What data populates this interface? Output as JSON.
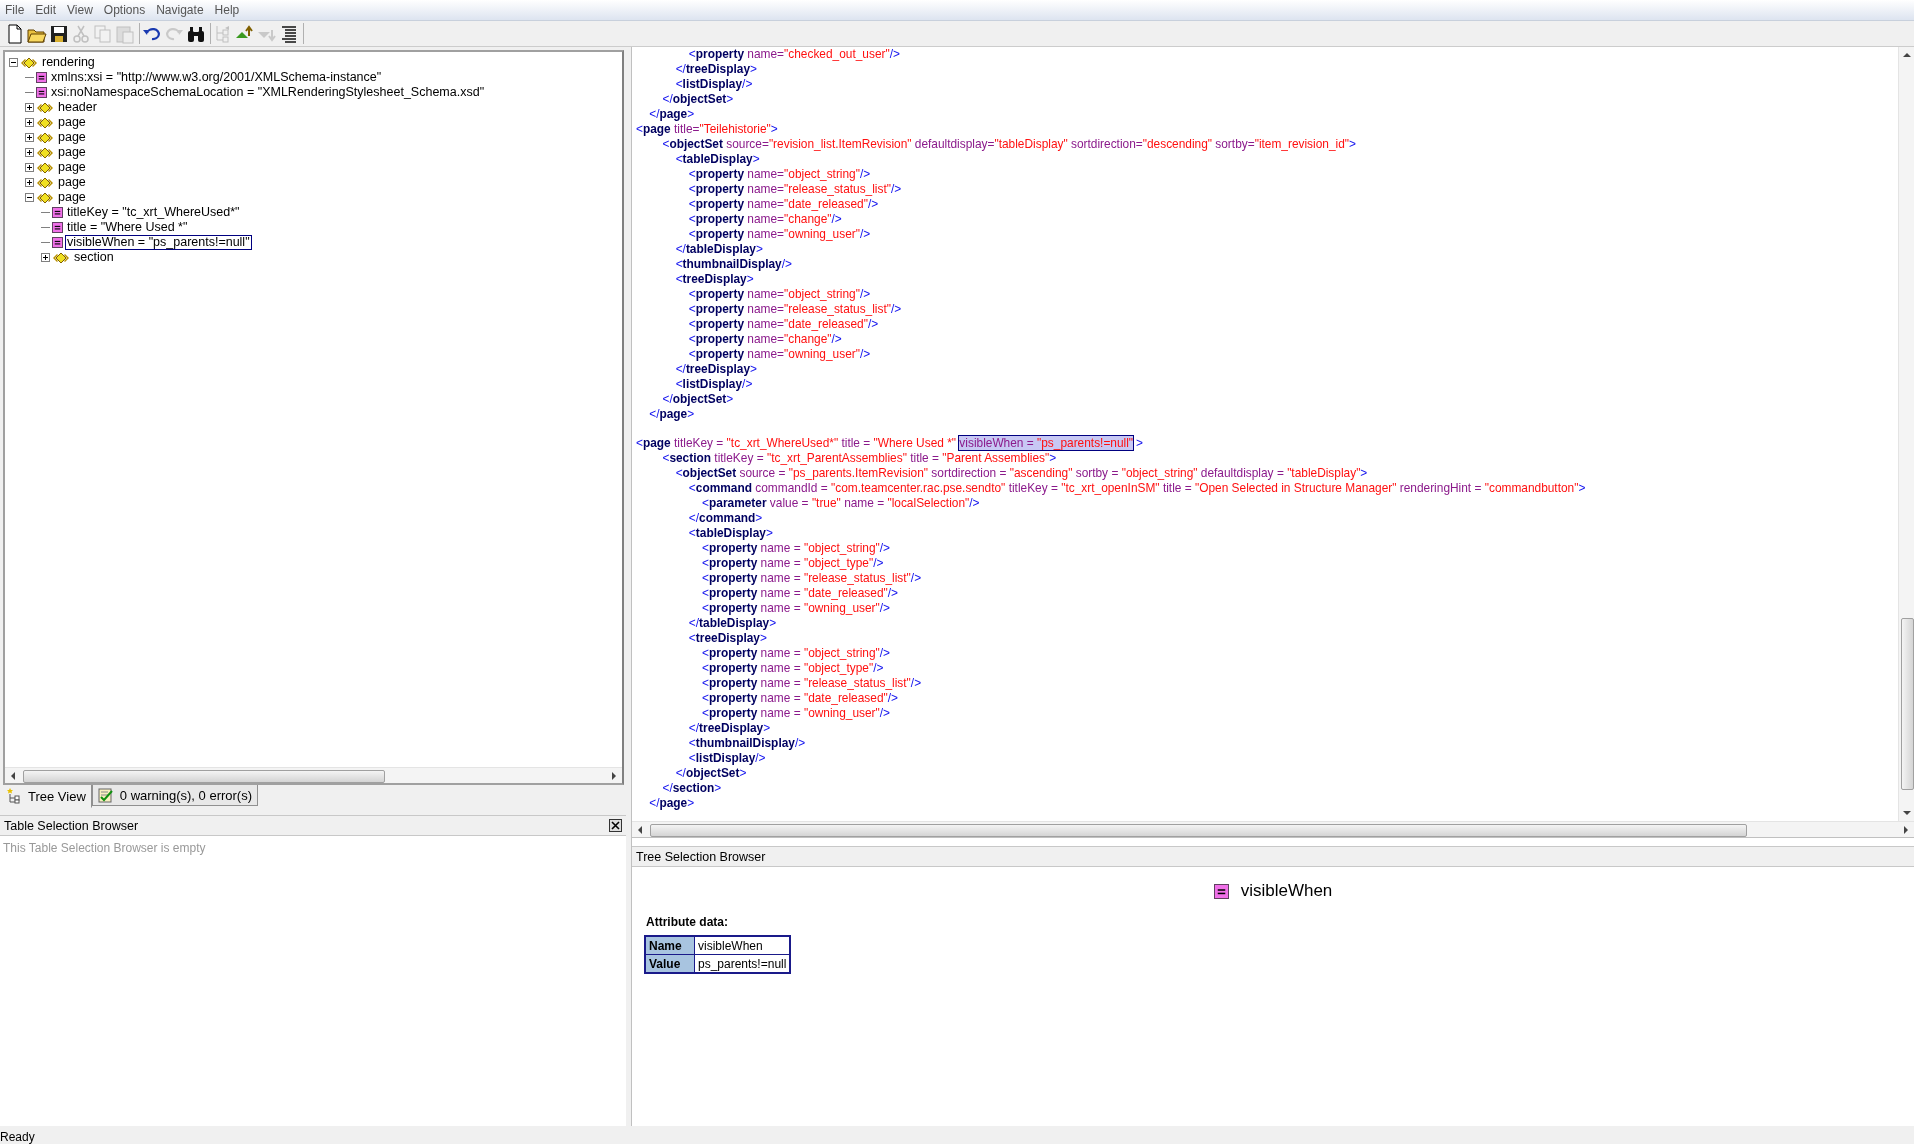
{
  "menu": [
    "File",
    "Edit",
    "View",
    "Options",
    "Navigate",
    "Help"
  ],
  "toolbar": [
    [
      {
        "kind": "new",
        "disabled": false
      },
      {
        "kind": "open",
        "disabled": false
      },
      {
        "kind": "save",
        "disabled": false
      },
      {
        "kind": "cut",
        "disabled": true
      },
      {
        "kind": "copy",
        "disabled": true
      },
      {
        "kind": "paste",
        "disabled": true
      }
    ],
    [
      {
        "kind": "undo",
        "disabled": false
      },
      {
        "kind": "redo",
        "disabled": true
      },
      {
        "kind": "find",
        "disabled": false
      }
    ],
    [
      {
        "kind": "tree",
        "disabled": true
      },
      {
        "kind": "up",
        "disabled": false
      },
      {
        "kind": "down",
        "disabled": true
      },
      {
        "kind": "list",
        "disabled": false
      }
    ]
  ],
  "tree": [
    {
      "kind": "element",
      "label": "rendering",
      "expanded": true,
      "selected": false,
      "children": [
        {
          "kind": "attribute",
          "label": "xmlns:xsi = \"http://www.w3.org/2001/XMLSchema-instance\"",
          "selected": false
        },
        {
          "kind": "attribute",
          "label": "xsi:noNamespaceSchemaLocation = \"XMLRenderingStylesheet_Schema.xsd\"",
          "selected": false
        },
        {
          "kind": "element",
          "label": "header",
          "expanded": false,
          "selected": false
        },
        {
          "kind": "element",
          "label": "page",
          "expanded": false,
          "selected": false
        },
        {
          "kind": "element",
          "label": "page",
          "expanded": false,
          "selected": false
        },
        {
          "kind": "element",
          "label": "page",
          "expanded": false,
          "selected": false
        },
        {
          "kind": "element",
          "label": "page",
          "expanded": false,
          "selected": false
        },
        {
          "kind": "element",
          "label": "page",
          "expanded": false,
          "selected": false
        },
        {
          "kind": "element",
          "label": "page",
          "expanded": true,
          "selected": false,
          "children": [
            {
              "kind": "attribute",
              "label": "titleKey = \"tc_xrt_WhereUsed*\"",
              "selected": false
            },
            {
              "kind": "attribute",
              "label": "title = \"Where Used *\"",
              "selected": false
            },
            {
              "kind": "attribute",
              "label": "visibleWhen = \"ps_parents!=null\"",
              "selected": true
            },
            {
              "kind": "element",
              "label": "section",
              "expanded": false,
              "selected": false
            }
          ]
        }
      ]
    }
  ],
  "tabs": [
    {
      "kind": "tree",
      "label": "Tree View",
      "selected": true
    },
    {
      "kind": "check",
      "label": "0 warning(s), 0 error(s)",
      "selected": false
    }
  ],
  "table_browser": {
    "title": "Table Selection Browser",
    "message": "This Table Selection Browser is empty"
  },
  "code_blocks": [
    {
      "lines": [
        {
          "code": "                <property name=\"checked_out_user\"/>"
        },
        {
          "code": "            </treeDisplay>"
        },
        {
          "code": "            <listDisplay/>"
        },
        {
          "code": "        </objectSet>"
        },
        {
          "code": "    </page>"
        },
        {
          "code": "<page title=\"Teilehistorie\">"
        },
        {
          "code": "        <objectSet source=\"revision_list.ItemRevision\" defaultdisplay=\"tableDisplay\" sortdirection=\"descending\" sortby=\"item_revision_id\">"
        },
        {
          "code": "            <tableDisplay>"
        },
        {
          "code": "                <property name=\"object_string\"/>"
        },
        {
          "code": "                <property name=\"release_status_list\"/>"
        },
        {
          "code": "                <property name=\"date_released\"/>"
        },
        {
          "code": "                <property name=\"change\"/>"
        },
        {
          "code": "                <property name=\"owning_user\"/>"
        },
        {
          "code": "            </tableDisplay>"
        },
        {
          "code": "            <thumbnailDisplay/>"
        },
        {
          "code": "            <treeDisplay>"
        },
        {
          "code": "                <property name=\"object_string\"/>"
        },
        {
          "code": "                <property name=\"release_status_list\"/>"
        },
        {
          "code": "                <property name=\"date_released\"/>"
        },
        {
          "code": "                <property name=\"change\"/>"
        },
        {
          "code": "                <property name=\"owning_user\"/>"
        },
        {
          "code": "            </treeDisplay>"
        },
        {
          "code": "            <listDisplay/>"
        },
        {
          "code": "        </objectSet>"
        },
        {
          "code": "    </page>"
        }
      ]
    },
    {
      "lines": [
        {
          "code": "<page titleKey = \"tc_xrt_WhereUsed*\" title = \"Where Used *\" ",
          "selection": "visibleWhen = \"ps_parents!=null\"",
          "code_after": ">"
        },
        {
          "code": "        <section titleKey = \"tc_xrt_ParentAssemblies\" title = \"Parent Assemblies\">"
        },
        {
          "code": "            <objectSet source = \"ps_parents.ItemRevision\" sortdirection = \"ascending\" sortby = \"object_string\" defaultdisplay = \"tableDisplay\">"
        },
        {
          "code": "                <command commandId = \"com.teamcenter.rac.pse.sendto\" titleKey = \"tc_xrt_openInSM\" title = \"Open Selected in Structure Manager\" renderingHint = \"commandbutton\">"
        },
        {
          "code": "                    <parameter value = \"true\" name = \"localSelection\"/>"
        },
        {
          "code": "                </command>"
        },
        {
          "code": "                <tableDisplay>"
        },
        {
          "code": "                    <property name = \"object_string\"/>"
        },
        {
          "code": "                    <property name = \"object_type\"/>"
        },
        {
          "code": "                    <property name = \"release_status_list\"/>"
        },
        {
          "code": "                    <property name = \"date_released\"/>"
        },
        {
          "code": "                    <property name = \"owning_user\"/>"
        },
        {
          "code": "                </tableDisplay>"
        },
        {
          "code": "                <treeDisplay>"
        },
        {
          "code": "                    <property name = \"object_string\"/>"
        },
        {
          "code": "                    <property name = \"object_type\"/>"
        },
        {
          "code": "                    <property name = \"release_status_list\"/>"
        },
        {
          "code": "                    <property name = \"date_released\"/>"
        },
        {
          "code": "                    <property name = \"owning_user\"/>"
        },
        {
          "code": "                </treeDisplay>"
        },
        {
          "code": "                <thumbnailDisplay/>"
        },
        {
          "code": "                <listDisplay/>"
        },
        {
          "code": "            </objectSet>"
        },
        {
          "code": "        </section>"
        },
        {
          "code": "    </page>"
        }
      ]
    }
  ],
  "tree_browser": {
    "title": "Tree Selection Browser",
    "kind": "attribute",
    "node_name": "visibleWhen",
    "section_label": "Attribute data:",
    "rows": [
      {
        "label": "Name",
        "value": "visibleWhen"
      },
      {
        "label": "Value",
        "value": "ps_parents!=null"
      }
    ]
  },
  "status_bar": "Ready"
}
